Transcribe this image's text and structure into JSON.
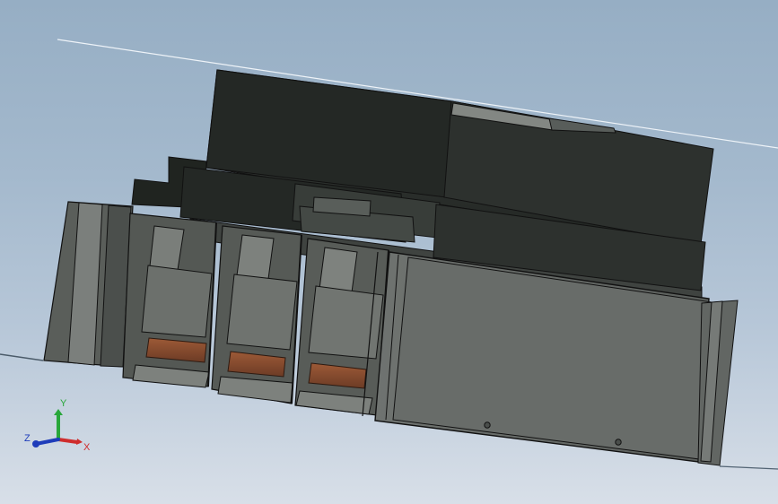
{
  "viewport": {
    "background_top": "#96aec4",
    "background_bottom": "#d8dfe8",
    "model_colors": {
      "dark_body": "#252a27",
      "mid_body": "#515552",
      "light_panel": "#727674",
      "contact_copper": "#8b4f31",
      "edge": "#1b1c1b"
    }
  },
  "triad": {
    "x_label": "X",
    "y_label": "Y",
    "z_label": "Z",
    "x_color": "#cf2d2d",
    "y_color": "#28a73a",
    "z_color": "#1e3cba"
  }
}
